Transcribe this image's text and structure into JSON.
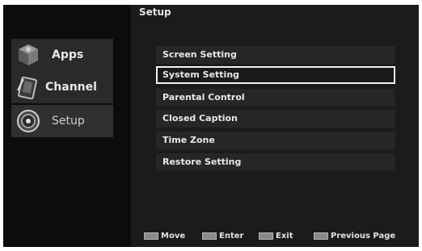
{
  "title": "Setup",
  "sidebar": {
    "items": [
      {
        "label": "Apps",
        "icon": "apps-icon"
      },
      {
        "label": "Channel",
        "icon": "channel-icon"
      },
      {
        "label": "Setup",
        "icon": "setup-icon"
      }
    ]
  },
  "menu": {
    "items": [
      {
        "label": "Screen Setting"
      },
      {
        "label": "System Setting"
      },
      {
        "label": "Parental Control"
      },
      {
        "label": "Closed Caption"
      },
      {
        "label": "Time Zone"
      },
      {
        "label": "Restore Setting"
      }
    ],
    "selected_label": "System Setting"
  },
  "footer": {
    "move": "Move",
    "enter": "Enter",
    "exit": "Exit",
    "previous": "Previous Page"
  }
}
